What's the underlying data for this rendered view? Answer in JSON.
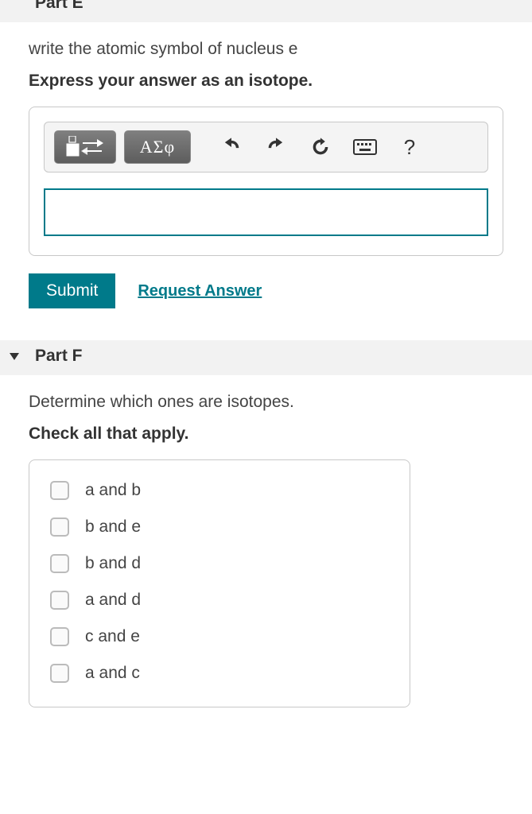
{
  "partE": {
    "heading": "Part E",
    "question": "write the atomic symbol of nucleus e",
    "instruction": "Express your answer as an isotope.",
    "toolbar": {
      "templates_label": "template-icon",
      "greek_label": "ΑΣφ",
      "undo": "undo",
      "redo": "redo",
      "reset": "reset",
      "keyboard": "keyboard",
      "help": "?"
    },
    "input_value": "",
    "submit_label": "Submit",
    "request_answer_label": "Request Answer"
  },
  "partF": {
    "heading": "Part F",
    "question": "Determine which ones are isotopes.",
    "instruction": "Check all that apply.",
    "choices": [
      "a and b",
      "b and e",
      "b and d",
      "a and d",
      "c and e",
      "a and c"
    ]
  }
}
